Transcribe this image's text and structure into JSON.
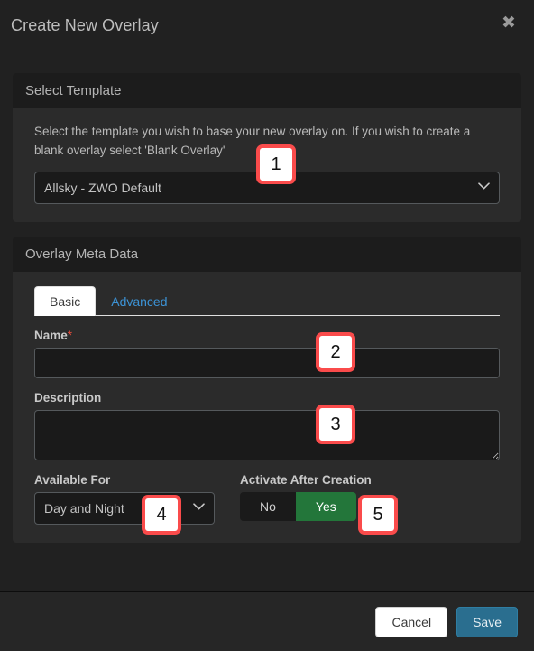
{
  "modal": {
    "title": "Create New Overlay",
    "close_icon": "close-icon"
  },
  "select_template": {
    "header": "Select Template",
    "help_text": "Select the template you wish to base your new overlay on. If you wish to create a blank overlay select 'Blank Overlay'",
    "selected": "Allsky - ZWO Default",
    "options": [
      "Allsky - ZWO Default"
    ],
    "chevron_icon": "chevron-down-icon"
  },
  "meta_data": {
    "header": "Overlay Meta Data",
    "tabs": [
      {
        "label": "Basic",
        "active": true
      },
      {
        "label": "Advanced",
        "active": false
      }
    ],
    "name": {
      "label": "Name",
      "required_marker": "*",
      "value": "",
      "placeholder": ""
    },
    "description": {
      "label": "Description",
      "value": "",
      "placeholder": ""
    },
    "available_for": {
      "label": "Available For",
      "selected": "Day and Night",
      "options": [
        "Day and Night"
      ],
      "chevron_icon": "chevron-down-icon"
    },
    "activate_after_creation": {
      "label": "Activate After Creation",
      "no_label": "No",
      "yes_label": "Yes",
      "selected": "Yes"
    }
  },
  "footer": {
    "cancel_label": "Cancel",
    "save_label": "Save"
  },
  "annotations": [
    {
      "id": "1",
      "number": "1"
    },
    {
      "id": "2",
      "number": "2"
    },
    {
      "id": "3",
      "number": "3"
    },
    {
      "id": "4",
      "number": "4"
    },
    {
      "id": "5",
      "number": "5"
    }
  ],
  "colors": {
    "accent_blue": "#2a6e8f",
    "link_blue": "#3c93d6",
    "toggle_green": "#23763a",
    "required_red": "#e74c3c",
    "annotation_red": "#fa4b4b"
  }
}
